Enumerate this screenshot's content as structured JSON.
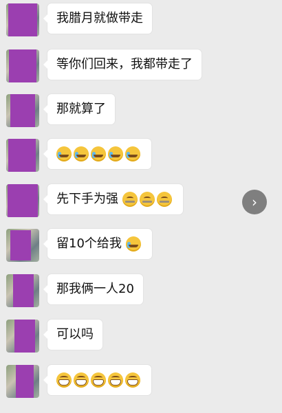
{
  "messages": [
    {
      "text": "我腊月就做带走",
      "emoji": []
    },
    {
      "text": "等你们回来，我都带走了",
      "emoji": []
    },
    {
      "text": "那就算了",
      "emoji": []
    },
    {
      "text": "",
      "emoji": [
        "cry-laugh-emoji",
        "cry-laugh-emoji",
        "cry-laugh-emoji",
        "cry-laugh-emoji",
        "cry-laugh-emoji"
      ]
    },
    {
      "text": "先下手为强",
      "emoji": [
        "zipper-mouth-emoji",
        "zipper-mouth-emoji",
        "zipper-mouth-emoji"
      ]
    },
    {
      "text": "留10个给我",
      "emoji": [
        "cry-laugh-emoji"
      ]
    },
    {
      "text": "那我俩一人20",
      "emoji": []
    },
    {
      "text": "可以吗",
      "emoji": []
    },
    {
      "text": "",
      "emoji": [
        "grin-emoji",
        "grin-emoji",
        "grin-emoji",
        "grin-emoji",
        "grin-emoji"
      ]
    }
  ],
  "nav_button": {
    "icon": "chevron-right-icon",
    "glyph": "›"
  },
  "colors": {
    "background": "#ebebeb",
    "bubble": "#ffffff",
    "avatar_mask": "#9b3fb0"
  }
}
